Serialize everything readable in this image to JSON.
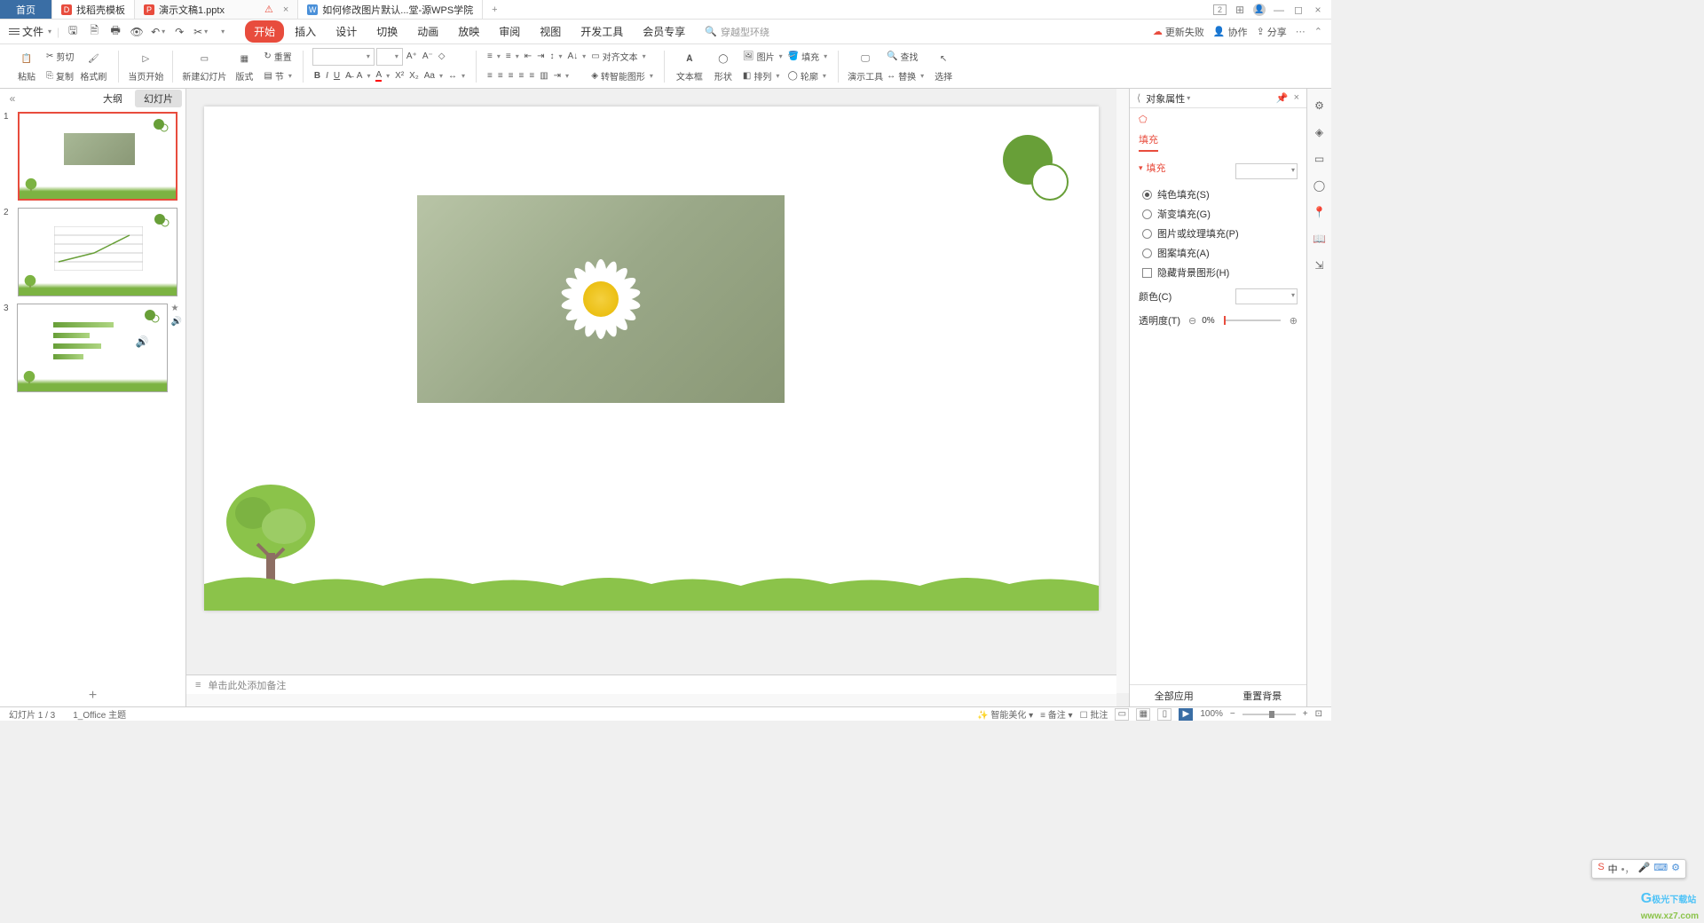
{
  "titlebar": {
    "home": "首页",
    "tabs": [
      {
        "icon": "template-icon",
        "label": "找稻壳模板"
      },
      {
        "icon": "ppt-icon",
        "label": "演示文稿1.pptx"
      },
      {
        "icon": "wps-icon",
        "label": "如何修改图片默认...堂-源WPS学院"
      }
    ],
    "badge": "2",
    "indicator": "1"
  },
  "menubar": {
    "file": "文件",
    "tabs": [
      "开始",
      "插入",
      "设计",
      "切换",
      "动画",
      "放映",
      "审阅",
      "视图",
      "开发工具",
      "会员专享"
    ],
    "search_placeholder": "穿越型环绕",
    "right": {
      "update": "更新失败",
      "collab": "协作",
      "share": "分享"
    }
  },
  "ribbon": {
    "paste": "粘贴",
    "cut": "剪切",
    "copy": "复制",
    "format_painter": "格式刷",
    "from_current": "当页开始",
    "new_slide": "新建幻灯片",
    "layout": "版式",
    "section": "节",
    "reset": "重置",
    "align_text": "对齐文本",
    "convert_smartart": "转智能图形",
    "text_box": "文本框",
    "shape": "形状",
    "picture": "图片",
    "arrange": "排列",
    "fill": "填充",
    "outline": "轮廓",
    "demo_tools": "演示工具",
    "find": "查找",
    "replace": "替换",
    "select": "选择"
  },
  "slidepanel": {
    "outline": "大纲",
    "slides": "幻灯片",
    "nums": [
      "1",
      "2",
      "3"
    ]
  },
  "notes": {
    "placeholder": "单击此处添加备注"
  },
  "props": {
    "title": "对象属性",
    "tab": "填充",
    "section": "填充",
    "solid": "纯色填充(S)",
    "gradient": "渐变填充(G)",
    "picture": "图片或纹理填充(P)",
    "pattern": "图案填充(A)",
    "hide_bg": "隐藏背景图形(H)",
    "color": "颜色(C)",
    "transparency": "透明度(T)",
    "transparency_val": "0%",
    "apply_all": "全部应用",
    "reset_bg": "重置背景"
  },
  "statusbar": {
    "slide_info": "幻灯片 1 / 3",
    "theme": "1_Office 主题",
    "beautify": "智能美化",
    "notes": "备注",
    "comments": "批注",
    "zoom": "100%"
  },
  "watermark": {
    "brand": "极光下载站",
    "url": "www.xz7.com"
  }
}
